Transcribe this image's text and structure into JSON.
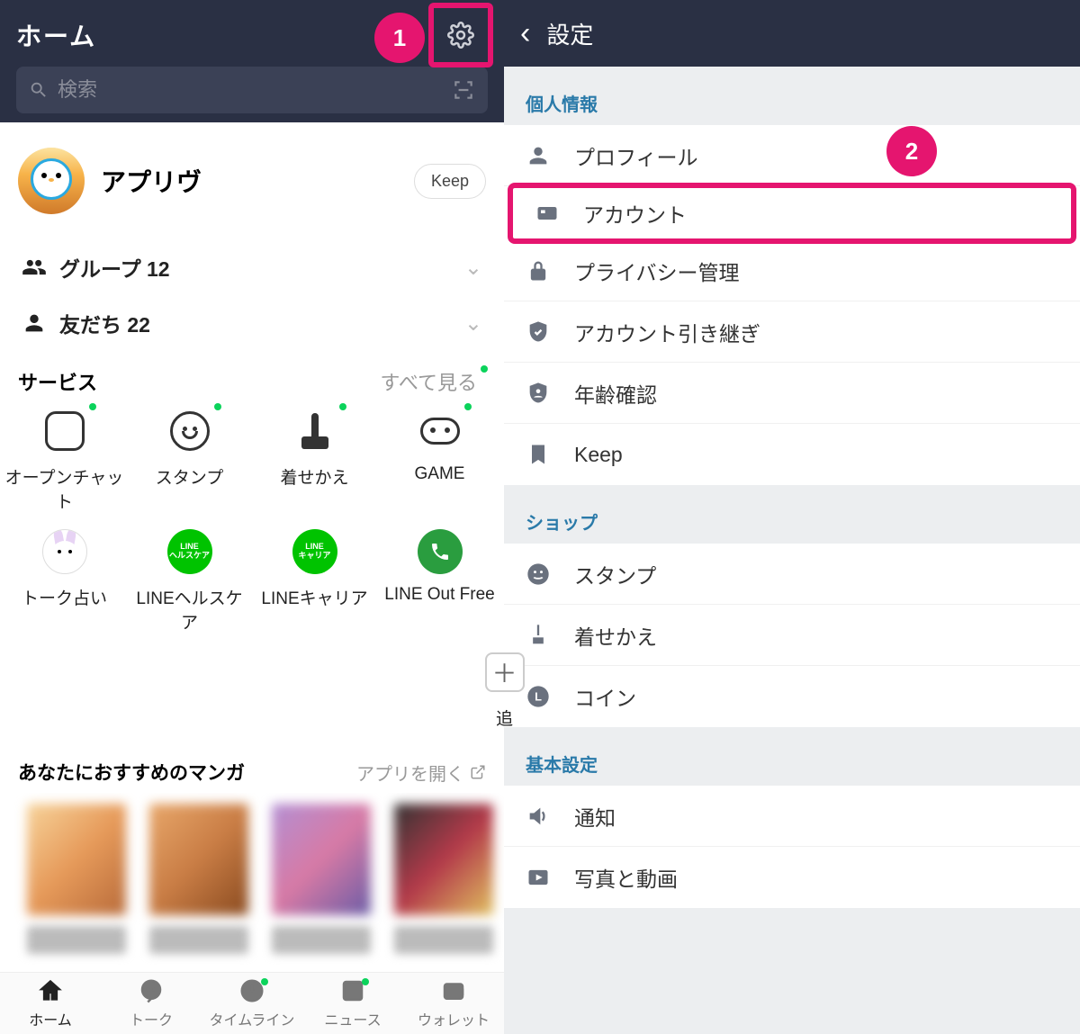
{
  "left": {
    "title": "ホーム",
    "search_placeholder": "検索",
    "profile_name": "アプリヴ",
    "keep_label": "Keep",
    "groups_label": "グループ 12",
    "friends_label": "友だち 22",
    "services_label": "サービス",
    "see_all_label": "すべて見る",
    "services": {
      "openchat": "オープンチャット",
      "stamp": "スタンプ",
      "kisekae": "着せかえ",
      "game": "GAME",
      "talk_uranai": "トーク占い",
      "healthcare": "LINEヘルスケア",
      "healthcare_badge": "LINE\nヘルスケア",
      "career": "LINEキャリア",
      "career_badge": "LINE\nキャリア",
      "out_free": "LINE Out Free",
      "add": "追"
    },
    "manga_heading": "あなたにおすすめのマンガ",
    "manga_open_label": "アプリを開く",
    "tabs": {
      "home": "ホーム",
      "talk": "トーク",
      "timeline": "タイムライン",
      "news": "ニュース",
      "wallet": "ウォレット"
    }
  },
  "right": {
    "title": "設定",
    "sections": {
      "personal": {
        "label": "個人情報",
        "items": {
          "profile": "プロフィール",
          "account": "アカウント",
          "privacy": "プライバシー管理",
          "transfer": "アカウント引き継ぎ",
          "age": "年齢確認",
          "keep": "Keep"
        }
      },
      "shop": {
        "label": "ショップ",
        "items": {
          "stamp": "スタンプ",
          "kisekae": "着せかえ",
          "coin": "コイン"
        }
      },
      "basic": {
        "label": "基本設定",
        "items": {
          "notify": "通知",
          "photo_video": "写真と動画"
        }
      }
    }
  },
  "callouts": {
    "one": "1",
    "two": "2"
  }
}
